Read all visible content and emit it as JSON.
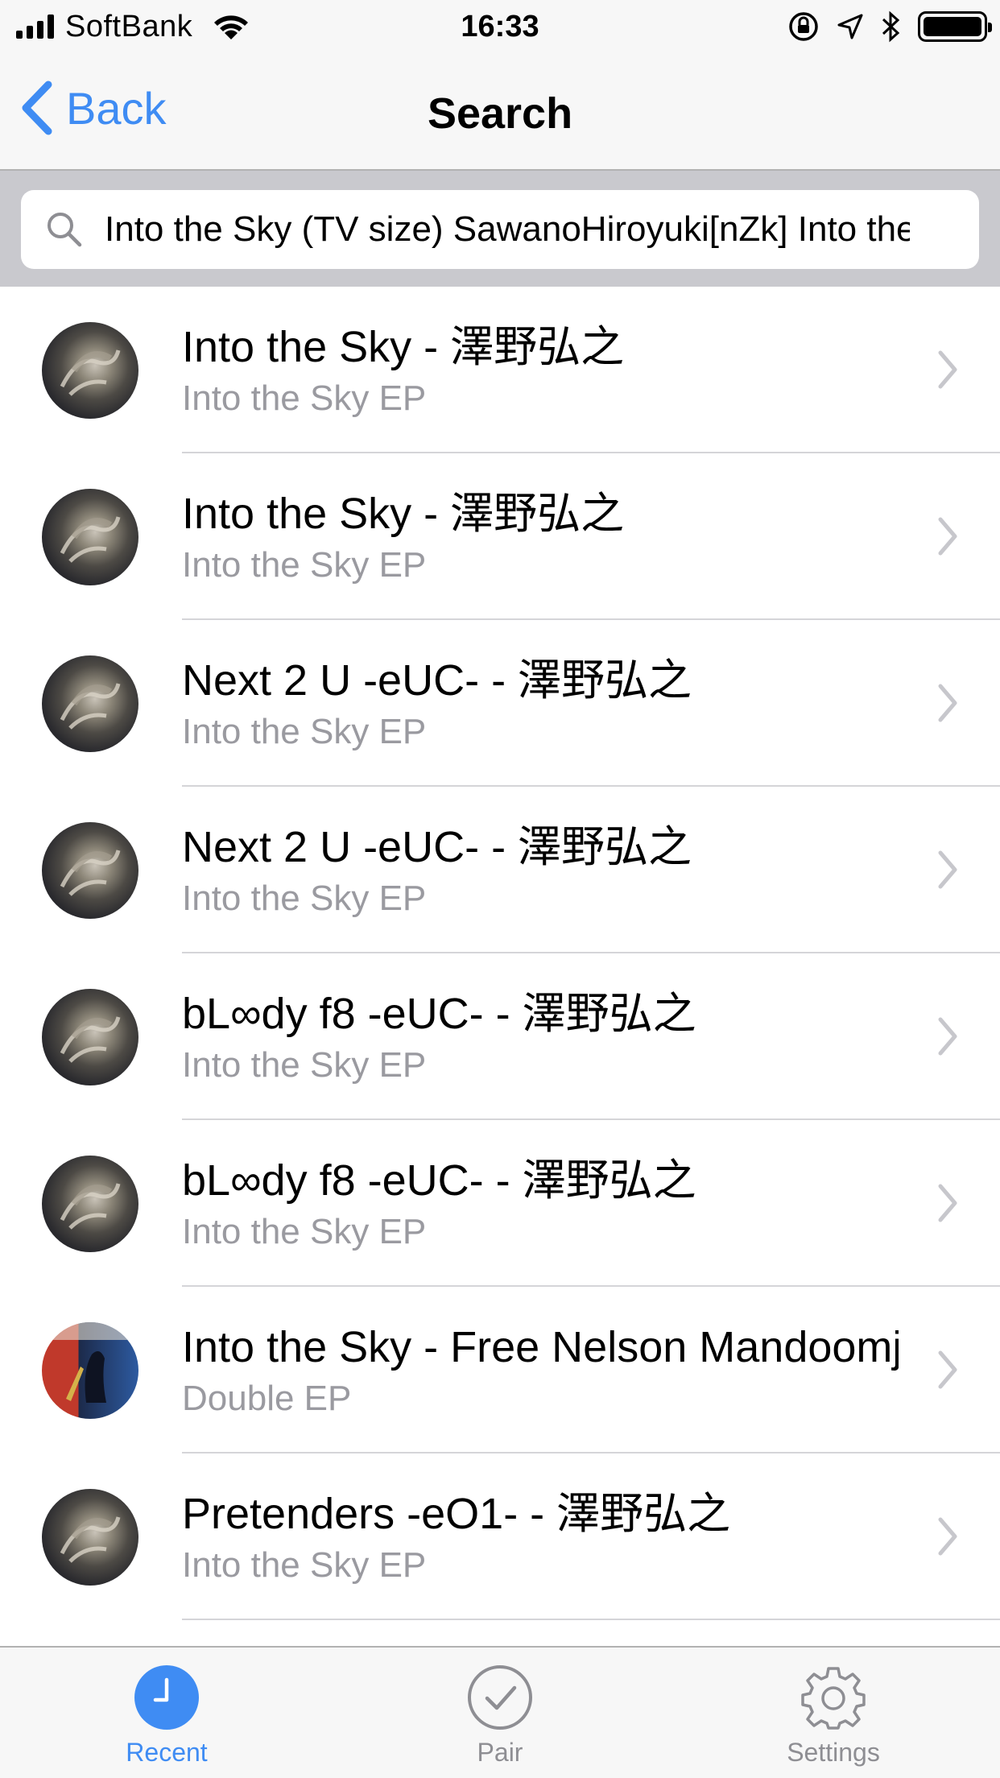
{
  "status_bar": {
    "carrier": "SoftBank",
    "time": "16:33"
  },
  "nav": {
    "back_label": "Back",
    "title": "Search"
  },
  "search": {
    "value": "Into the Sky (TV size) SawanoHiroyuki[nZk] Into the Sky EP"
  },
  "results": [
    {
      "title": "Into the Sky - 澤野弘之",
      "subtitle": "Into the Sky EP",
      "art": "album-art"
    },
    {
      "title": "Into the Sky - 澤野弘之",
      "subtitle": "Into the Sky EP",
      "art": "album-art"
    },
    {
      "title": "Next 2 U -eUC- - 澤野弘之",
      "subtitle": "Into the Sky EP",
      "art": "album-art"
    },
    {
      "title": "Next 2 U -eUC- - 澤野弘之",
      "subtitle": "Into the Sky EP",
      "art": "album-art"
    },
    {
      "title": "bL∞dy f8 -eUC- - 澤野弘之",
      "subtitle": "Into the Sky EP",
      "art": "album-art"
    },
    {
      "title": "bL∞dy f8 -eUC- - 澤野弘之",
      "subtitle": "Into the Sky EP",
      "art": "album-art"
    },
    {
      "title": "Into the Sky - Free Nelson Mandoomjazz",
      "subtitle": "Double EP",
      "art": "album-art-alt"
    },
    {
      "title": "Pretenders -eO1- - 澤野弘之",
      "subtitle": "Into the Sky EP",
      "art": "album-art"
    }
  ],
  "tabs": [
    {
      "label": "Recent",
      "icon": "clock-icon",
      "active": true
    },
    {
      "label": "Pair",
      "icon": "checkmark-circle-icon",
      "active": false
    },
    {
      "label": "Settings",
      "icon": "gear-icon",
      "active": false
    }
  ],
  "colors": {
    "accent": "#3f8cf3",
    "subtitle": "#9a9aa0",
    "inactive_tab": "#8e8e93"
  }
}
